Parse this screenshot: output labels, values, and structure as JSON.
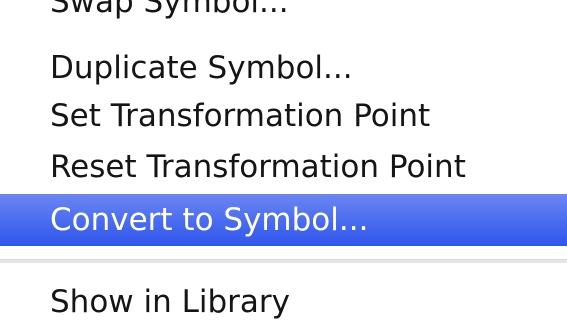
{
  "menu": {
    "items": [
      {
        "label": "Swap Symbol..."
      },
      {
        "label": "Duplicate Symbol..."
      },
      {
        "label": "Set Transformation Point"
      },
      {
        "label": "Reset Transformation Point"
      },
      {
        "label": "Convert to Symbol..."
      },
      {
        "label": "Show in Library"
      }
    ],
    "highlight_color": "#2f56ed"
  }
}
